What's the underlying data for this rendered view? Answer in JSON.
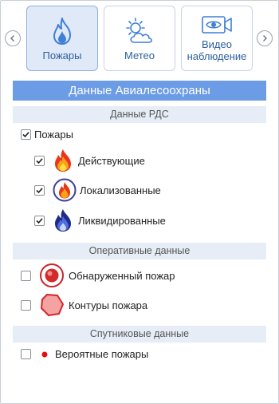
{
  "tabs": [
    {
      "label": "Пожары",
      "icon": "fire-icon",
      "active": true
    },
    {
      "label": "Метео",
      "icon": "weather-sun-cloud-icon",
      "active": false
    },
    {
      "label_line1": "Видео",
      "label_line2": "наблюдение",
      "icon": "video-camera-icon",
      "active": false
    }
  ],
  "main_header": "Данные Авиалесоохраны",
  "sections": {
    "rds": {
      "title": "Данные РДС",
      "parent": {
        "label": "Пожары",
        "checked": true
      },
      "items": [
        {
          "label": "Действующие",
          "checked": true,
          "icon": "active-fire-icon"
        },
        {
          "label": "Локализованные",
          "checked": true,
          "icon": "localized-fire-icon"
        },
        {
          "label": "Ликвидированные",
          "checked": true,
          "icon": "extinguished-fire-icon"
        }
      ]
    },
    "operational": {
      "title": "Оперативные данные",
      "items": [
        {
          "label": "Обнаруженный пожар",
          "checked": false,
          "icon": "detected-fire-icon"
        },
        {
          "label": "Контуры пожара",
          "checked": false,
          "icon": "fire-contour-icon"
        }
      ]
    },
    "satellite": {
      "title": "Спутниковые данные",
      "items": [
        {
          "label": "Вероятные пожары",
          "checked": false,
          "icon": "red-dot-icon"
        }
      ]
    }
  },
  "colors": {
    "accent": "#6d9ce6",
    "section_bg": "#e6edf6",
    "tab_active_bg": "#dfe9f8",
    "tab_text": "#2b5f9e"
  }
}
